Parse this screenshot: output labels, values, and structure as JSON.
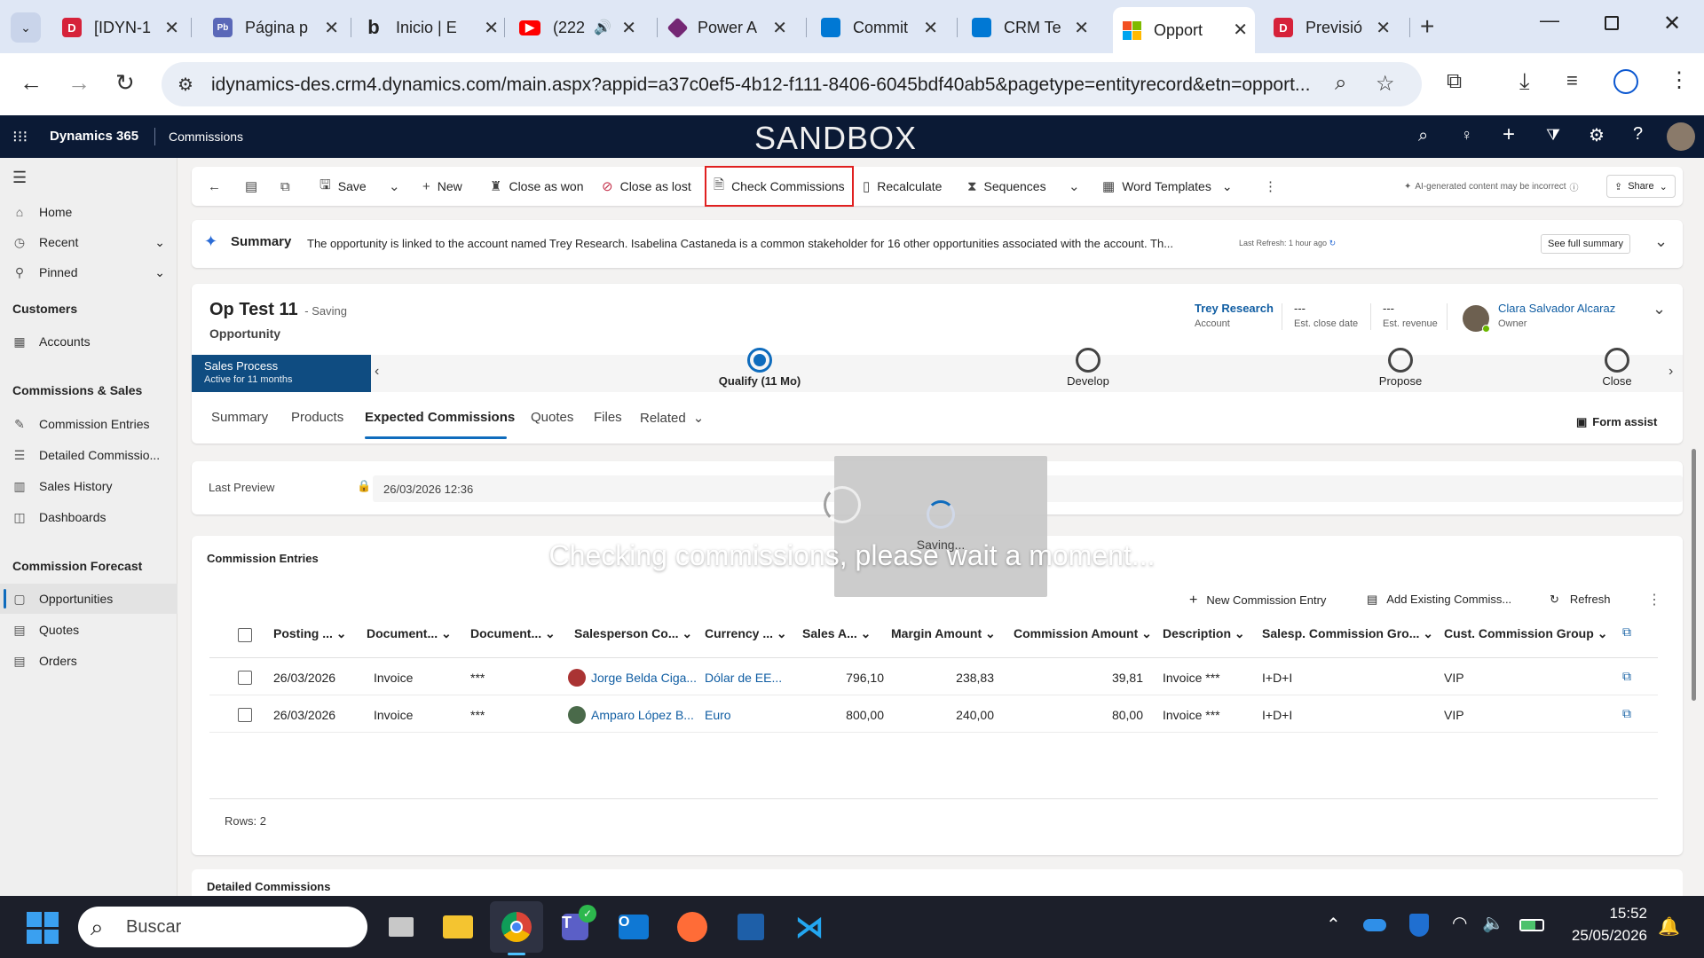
{
  "browser": {
    "tabs": [
      {
        "label": "[IDYN-1",
        "icon": "d-brand-icon",
        "color": "#d6223a"
      },
      {
        "label": "Página p",
        "icon": "project-icon",
        "color": "#5a68b8"
      },
      {
        "label": "Inicio | E",
        "icon": "b-icon",
        "color": "#222222"
      },
      {
        "label": "(222",
        "icon": "youtube-icon",
        "color": "#ff0000"
      },
      {
        "label": "Power A",
        "icon": "power-apps-icon",
        "color": "#742774"
      },
      {
        "label": "Commit",
        "icon": "devops-icon",
        "color": "#0078d4"
      },
      {
        "label": "CRM Te",
        "icon": "devops-icon",
        "color": "#0078d4"
      },
      {
        "label": "Opport",
        "icon": "microsoft-icon",
        "color": "#f25022"
      },
      {
        "label": "Previsió",
        "icon": "d-brand-icon",
        "color": "#d6223a"
      }
    ],
    "url": "idynamics-des.crm4.dynamics.com/main.aspx?appid=a37c0ef5-4b12-f111-8406-6045bdf40ab5&pagetype=entityrecord&etn=opport..."
  },
  "app": {
    "brand": "Dynamics 365",
    "module": "Commissions",
    "environment": "SANDBOX"
  },
  "nav": {
    "home": "Home",
    "recent": "Recent",
    "pinned": "Pinned",
    "group_customers": "Customers",
    "accounts": "Accounts",
    "group_commissions": "Commissions & Sales",
    "commission_entries": "Commission Entries",
    "detailed_commissions": "Detailed Commissio...",
    "sales_history": "Sales History",
    "dashboards": "Dashboards",
    "group_forecast": "Commission Forecast",
    "opportunities": "Opportunities",
    "quotes": "Quotes",
    "orders": "Orders"
  },
  "commands": {
    "save": "Save",
    "new": "New",
    "close_won": "Close as won",
    "close_lost": "Close as lost",
    "check_commissions": "Check Commissions",
    "recalculate": "Recalculate",
    "sequences": "Sequences",
    "word_templates": "Word Templates",
    "ai_note": "AI-generated content may be incorrect",
    "share": "Share"
  },
  "summary": {
    "label": "Summary",
    "text": "The opportunity is linked to the account named Trey Research. Isabelina Castaneda is a common stakeholder for 16 other opportunities associated with the account. Th...",
    "refresh": "Last Refresh: 1 hour ago",
    "see_full": "See full summary"
  },
  "record": {
    "title": "Op Test 11",
    "saving": "- Saving",
    "entity": "Opportunity",
    "account_value": "Trey Research",
    "account_label": "Account",
    "close_date_value": "---",
    "close_date_label": "Est. close date",
    "revenue_value": "---",
    "revenue_label": "Est. revenue",
    "owner_value": "Clara Salvador Alcaraz",
    "owner_label": "Owner"
  },
  "process": {
    "name": "Sales Process",
    "active": "Active for 11 months",
    "stages": [
      "Qualify  (11 Mo)",
      "Develop",
      "Propose",
      "Close"
    ]
  },
  "tabs": {
    "summary": "Summary",
    "products": "Products",
    "expected": "Expected Commissions",
    "quotes": "Quotes",
    "files": "Files",
    "related": "Related",
    "form_assist": "Form assist"
  },
  "fields": {
    "last_preview_label": "Last Preview",
    "last_preview_value": "26/03/2026 12:36"
  },
  "entries": {
    "title": "Commission Entries",
    "new_entry": "New Commission Entry",
    "add_existing": "Add Existing Commiss...",
    "refresh": "Refresh",
    "columns": [
      "Posting ...",
      "Document...",
      "Document...",
      "Salesperson Co...",
      "Currency ...",
      "Sales A...",
      "Margin Amount",
      "Commission Amount",
      "Description",
      "Salesp. Commission Gro...",
      "Cust. Commission Group"
    ],
    "rows": [
      [
        "26/03/2026",
        "Invoice",
        "***",
        "Jorge Belda Ciga...",
        "Dólar de EE...",
        "796,10",
        "238,83",
        "39,81",
        "Invoice ***",
        "I+D+I",
        "VIP"
      ],
      [
        "26/03/2026",
        "Invoice",
        "***",
        "Amparo López B...",
        "Euro",
        "800,00",
        "240,00",
        "80,00",
        "Invoice ***",
        "I+D+I",
        "VIP"
      ]
    ],
    "rows_count": "Rows: 2"
  },
  "detailed": {
    "title": "Detailed Commissions"
  },
  "overlay": {
    "saving": "Saving...",
    "checking": "Checking commissions, please wait a moment..."
  },
  "taskbar": {
    "search_placeholder": "Buscar",
    "time": "15:52",
    "date": "25/05/2026"
  }
}
